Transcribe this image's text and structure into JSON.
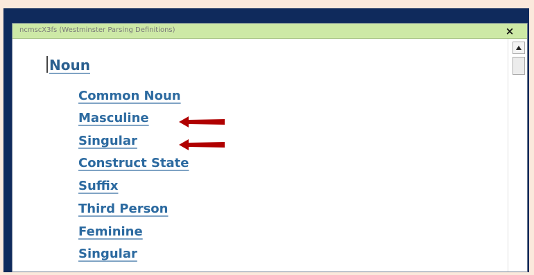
{
  "window": {
    "title": "ncmscX3fs (Westminster Parsing Definitions)",
    "close_label": "×"
  },
  "definitions": {
    "root": "Noun",
    "items": [
      "Common Noun",
      "Masculine",
      "Singular",
      "Construct State",
      "Suffix",
      "Third Person",
      "Feminine",
      "Singular"
    ],
    "highlighted_items": [
      "Masculine",
      "Singular"
    ]
  },
  "colors": {
    "page_background": "#fbe9dc",
    "frame": "#0f2a5c",
    "titlebar": "#cde9a6",
    "link_text": "#2c6aa0",
    "arrow": "#b00000"
  },
  "icons": {
    "close": "close-icon",
    "scroll_up": "scroll-up-arrow-icon",
    "arrows": "left-arrow-icon"
  }
}
